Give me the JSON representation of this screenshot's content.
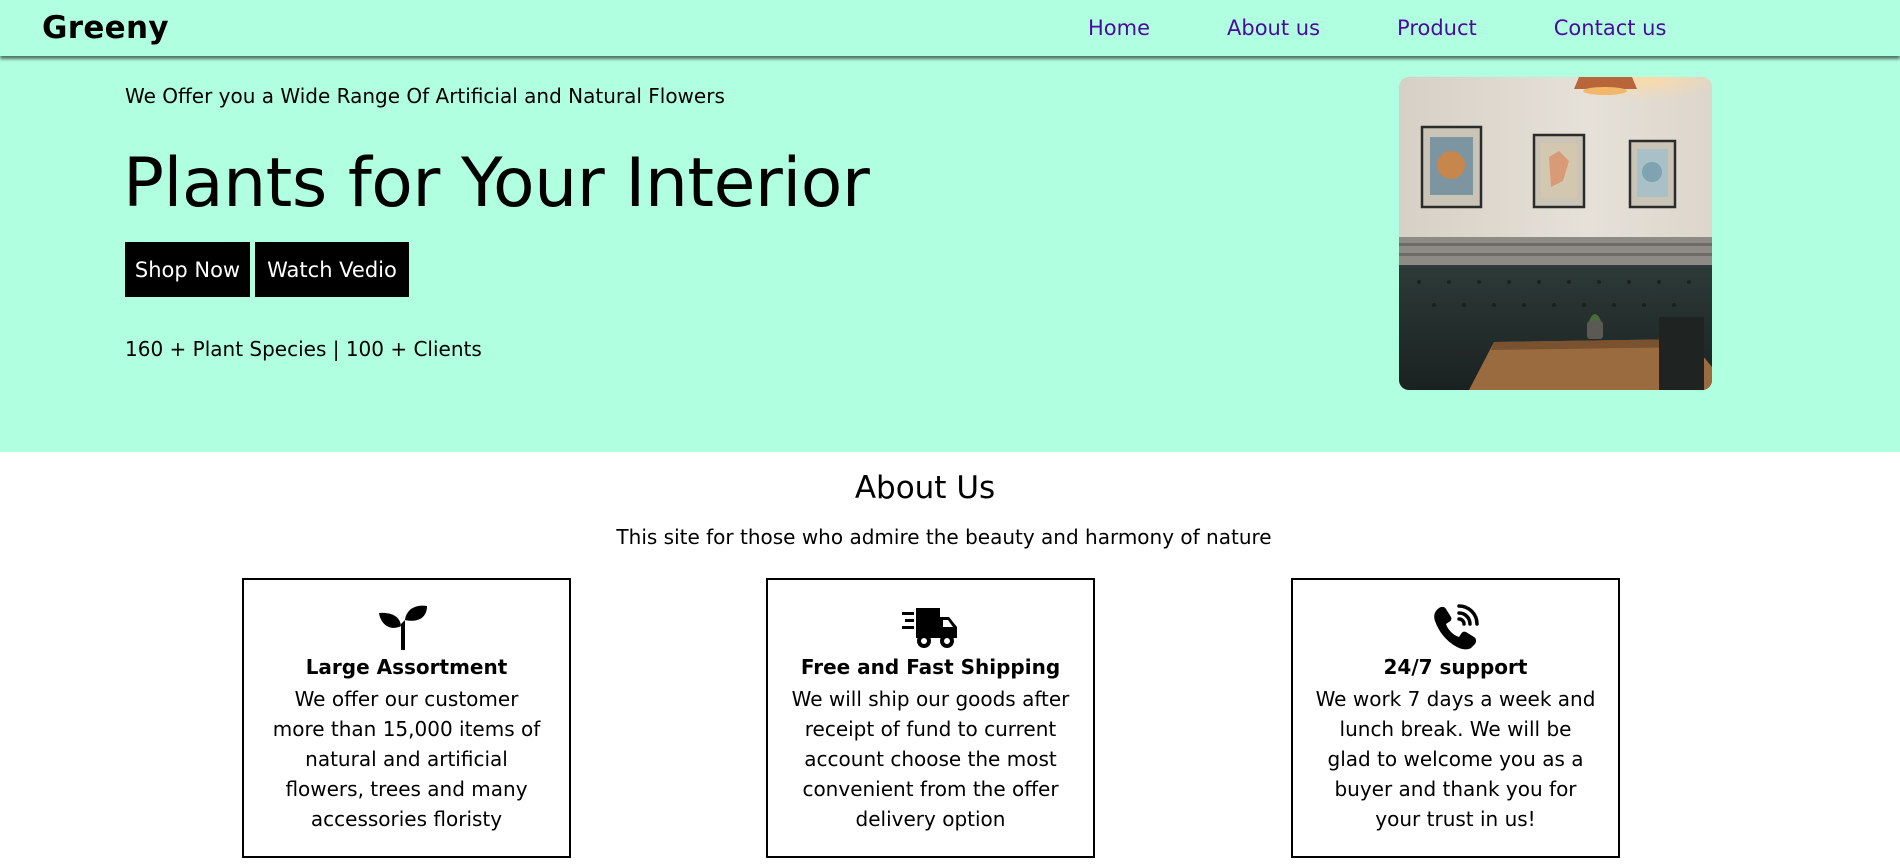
{
  "brand": {
    "logo": "Greeny",
    "colors": {
      "mint_background": "#b1ffe1",
      "nav_link": "#4b0a9e",
      "button": "#000000"
    }
  },
  "nav": {
    "links": [
      {
        "label": "Home"
      },
      {
        "label": "About us"
      },
      {
        "label": "Product"
      },
      {
        "label": "Contact us"
      }
    ]
  },
  "hero": {
    "kicker": "We Offer you a Wide Range Of Artificial and Natural Flowers",
    "title": "Plants for Your Interior",
    "buttons": {
      "shop": "Shop Now",
      "watch": "Watch Vedio"
    },
    "stats": "160 + Plant Species | 100 + Clients"
  },
  "about": {
    "title": "About Us",
    "subtitle": "This site for those who admire the beauty and harmony of nature",
    "cards": [
      {
        "icon": "sprout-icon",
        "title": "Large Assortment",
        "text": "We offer our customer more than 15,000 items of natural and artificial flowers, trees and many accessories floristy"
      },
      {
        "icon": "delivery-truck-icon",
        "title": "Free and Fast Shipping",
        "text": "We will ship our goods after receipt of fund to current account choose the most convenient from the offer delivery option"
      },
      {
        "icon": "phone-call-icon",
        "title": "24/7 support",
        "text": "We work 7 days a week and lunch break. We will be glad to welcome you as a buyer and thank you for your trust in us!"
      }
    ]
  }
}
